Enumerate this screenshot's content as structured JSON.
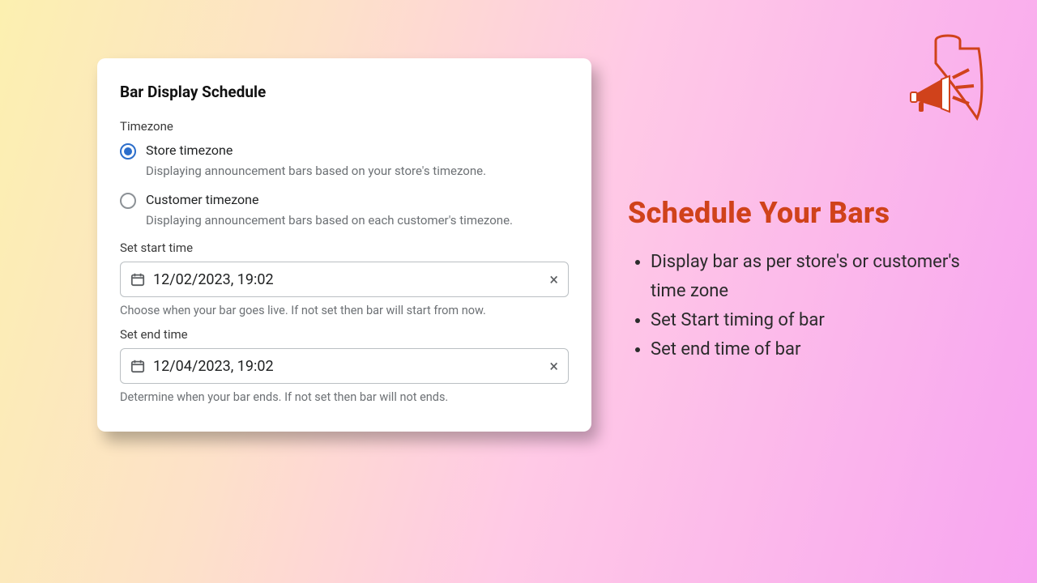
{
  "card": {
    "title": "Bar Display Schedule",
    "timezone_label": "Timezone",
    "options": {
      "store": {
        "label": "Store timezone",
        "desc": "Displaying announcement bars based on your store's timezone.",
        "selected": true
      },
      "customer": {
        "label": "Customer timezone",
        "desc": "Displaying announcement bars based on each customer's timezone.",
        "selected": false
      }
    },
    "start": {
      "label": "Set start time",
      "value": "12/02/2023, 19:02",
      "helper": "Choose when your bar goes live. If not set then bar will start from now."
    },
    "end": {
      "label": "Set end time",
      "value": "12/04/2023, 19:02",
      "helper": "Determine when your bar ends. If not set then bar will not ends."
    }
  },
  "promo": {
    "heading": "Schedule Your Bars",
    "bullets": [
      "Display bar as per store's or customer's time zone",
      "Set Start timing of bar",
      "Set end time of bar"
    ]
  },
  "colors": {
    "accent": "#d0421b",
    "radio": "#2c6ecb"
  }
}
